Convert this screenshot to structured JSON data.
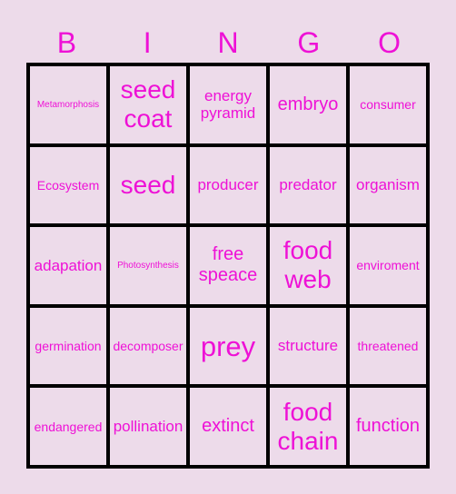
{
  "header": {
    "letters": [
      "B",
      "I",
      "N",
      "G",
      "O"
    ]
  },
  "colors": {
    "background": "#eddbea",
    "text": "#ee11d6",
    "grid_lines": "#000000"
  },
  "grid": {
    "rows": [
      [
        "Metamorphosis",
        "seed coat",
        "energy pyramid",
        "embryo",
        "consumer"
      ],
      [
        "Ecosystem",
        "seed",
        "producer",
        "predator",
        "organism"
      ],
      [
        "adapation",
        "Photosynthesis",
        "free speace",
        "food web",
        "enviroment"
      ],
      [
        "germination",
        "decomposer",
        "prey",
        "structure",
        "threatened"
      ],
      [
        "endangered",
        "pollination",
        "extinct",
        "food chain",
        "function"
      ]
    ]
  }
}
